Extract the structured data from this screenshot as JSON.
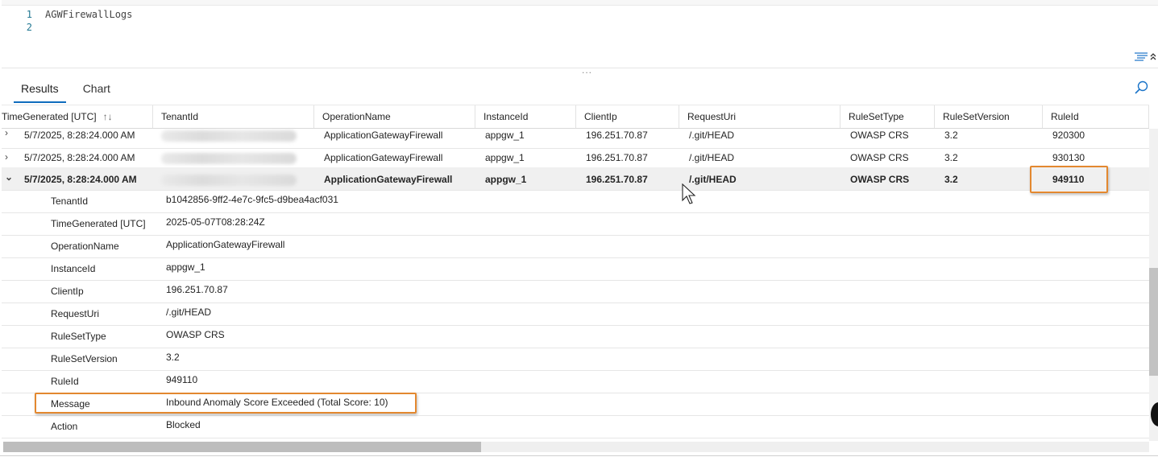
{
  "editor": {
    "lines": [
      {
        "num": "1",
        "text": "AGWFirewallLogs"
      },
      {
        "num": "2",
        "text": ""
      }
    ],
    "splitter_glyph": "..."
  },
  "tabs": [
    {
      "label": "Results",
      "active": true
    },
    {
      "label": "Chart",
      "active": false
    }
  ],
  "columns": [
    "TimeGenerated [UTC]",
    "TenantId",
    "OperationName",
    "InstanceId",
    "ClientIp",
    "RequestUri",
    "RuleSetType",
    "RuleSetVersion",
    "RuleId"
  ],
  "rows": [
    {
      "time": "5/7/2025, 8:28:24.000 AM",
      "operation": "ApplicationGatewayFirewall",
      "instance": "appgw_1",
      "client_ip": "196.251.70.87",
      "request_uri": "/.git/HEAD",
      "ruleset_type": "OWASP CRS",
      "ruleset_version": "3.2",
      "rule_id": "920300",
      "expanded": false
    },
    {
      "time": "5/7/2025, 8:28:24.000 AM",
      "operation": "ApplicationGatewayFirewall",
      "instance": "appgw_1",
      "client_ip": "196.251.70.87",
      "request_uri": "/.git/HEAD",
      "ruleset_type": "OWASP CRS",
      "ruleset_version": "3.2",
      "rule_id": "930130",
      "expanded": false
    },
    {
      "time": "5/7/2025, 8:28:24.000 AM",
      "operation": "ApplicationGatewayFirewall",
      "instance": "appgw_1",
      "client_ip": "196.251.70.87",
      "request_uri": "/.git/HEAD",
      "ruleset_type": "OWASP CRS",
      "ruleset_version": "3.2",
      "rule_id": "949110",
      "expanded": true
    }
  ],
  "details": [
    {
      "key": "TenantId",
      "value": "b1042856-9ff2-4e7c-9fc5-d9bea4acf031"
    },
    {
      "key": "TimeGenerated [UTC]",
      "value": "2025-05-07T08:28:24Z"
    },
    {
      "key": "OperationName",
      "value": "ApplicationGatewayFirewall"
    },
    {
      "key": "InstanceId",
      "value": "appgw_1"
    },
    {
      "key": "ClientIp",
      "value": "196.251.70.87"
    },
    {
      "key": "RequestUri",
      "value": "/.git/HEAD"
    },
    {
      "key": "RuleSetType",
      "value": "OWASP CRS"
    },
    {
      "key": "RuleSetVersion",
      "value": "3.2"
    },
    {
      "key": "RuleId",
      "value": "949110"
    },
    {
      "key": "Message",
      "value": "Inbound Anomaly Score Exceeded (Total Score: 10)"
    },
    {
      "key": "Action",
      "value": "Blocked"
    }
  ],
  "colors": {
    "accent": "#0f6cbd",
    "highlight": "#e3882f",
    "expanded_row": "#f0f0f0"
  },
  "icons": {
    "sort": "sort-icon",
    "search": "search-icon",
    "format": "format-icon",
    "collapse": "collapse-icon",
    "expand": "chevron-right-icon",
    "collapse_row": "chevron-down-icon"
  }
}
